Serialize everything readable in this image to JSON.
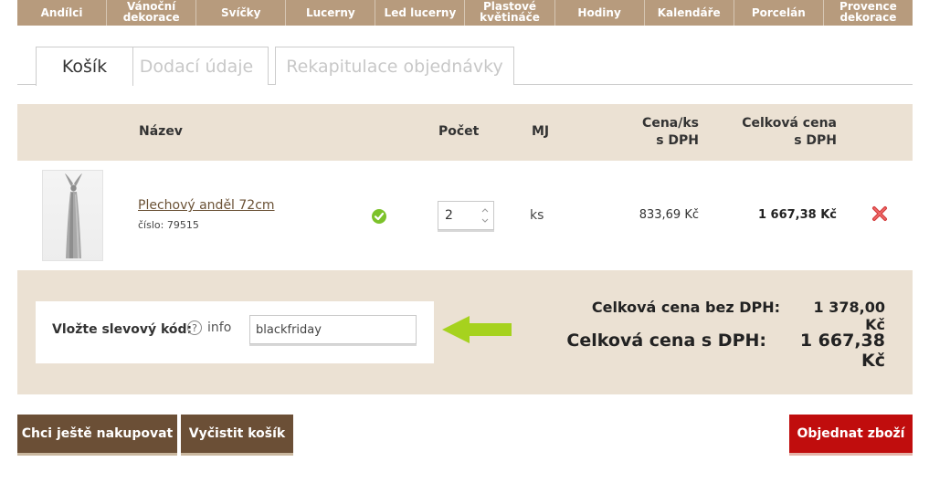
{
  "nav": {
    "items": [
      {
        "label": "Andílci",
        "two_line": false
      },
      {
        "label": "Vánoční\ndekorace",
        "two_line": true
      },
      {
        "label": "Svíčky",
        "two_line": false
      },
      {
        "label": "Lucerny",
        "two_line": false
      },
      {
        "label": "Led lucerny",
        "two_line": false
      },
      {
        "label": "Plastové\nkvětináče",
        "two_line": true
      },
      {
        "label": "Hodiny",
        "two_line": false
      },
      {
        "label": "Kalendáře",
        "two_line": false
      },
      {
        "label": "Porcelán",
        "two_line": false
      },
      {
        "label": "Provence\ndekorace",
        "two_line": true
      }
    ]
  },
  "tabs": [
    {
      "label": "Košík",
      "active": true
    },
    {
      "label": "Dodací údaje",
      "active": false
    },
    {
      "label": "Rekapitulace objednávky",
      "active": false
    }
  ],
  "cart": {
    "headers": {
      "name": "Název",
      "qty": "Počet",
      "unit": "MJ",
      "unit_price": "Cena/ks\ns DPH",
      "total": "Celková cena\ns DPH"
    },
    "rows": [
      {
        "name": "Plechový anděl 72cm",
        "code_label": "číslo:",
        "code": "79515",
        "quantity": "2",
        "unit": "ks",
        "unit_price": "833,69 Kč",
        "total": "1 667,38 Kč"
      }
    ]
  },
  "coupon": {
    "label": "Vložte slevový kód:",
    "info_icon": "?",
    "info_text": "info",
    "value": "blackfriday"
  },
  "totals": {
    "without_vat_label": "Celková cena bez DPH:",
    "without_vat_value": "1 378,00 Kč",
    "with_vat_label": "Celková cena s DPH:",
    "with_vat_value": "1 667,38 Kč"
  },
  "buttons": {
    "continue": "Chci ještě nakupovat",
    "clear": "Vyčistit košík",
    "order": "Objednat zboží"
  },
  "colors": {
    "nav_bg": "#b79b7d",
    "header_bg": "#ebe1d3",
    "button_brown": "#6b4f36",
    "button_red": "#c00d0d",
    "arrow_green": "#a6d21e"
  },
  "icons": {
    "stock": "check-circle-icon",
    "delete": "red-x-icon",
    "qty": "spinner-arrows-icon",
    "arrow": "green-arrow-left-icon"
  }
}
